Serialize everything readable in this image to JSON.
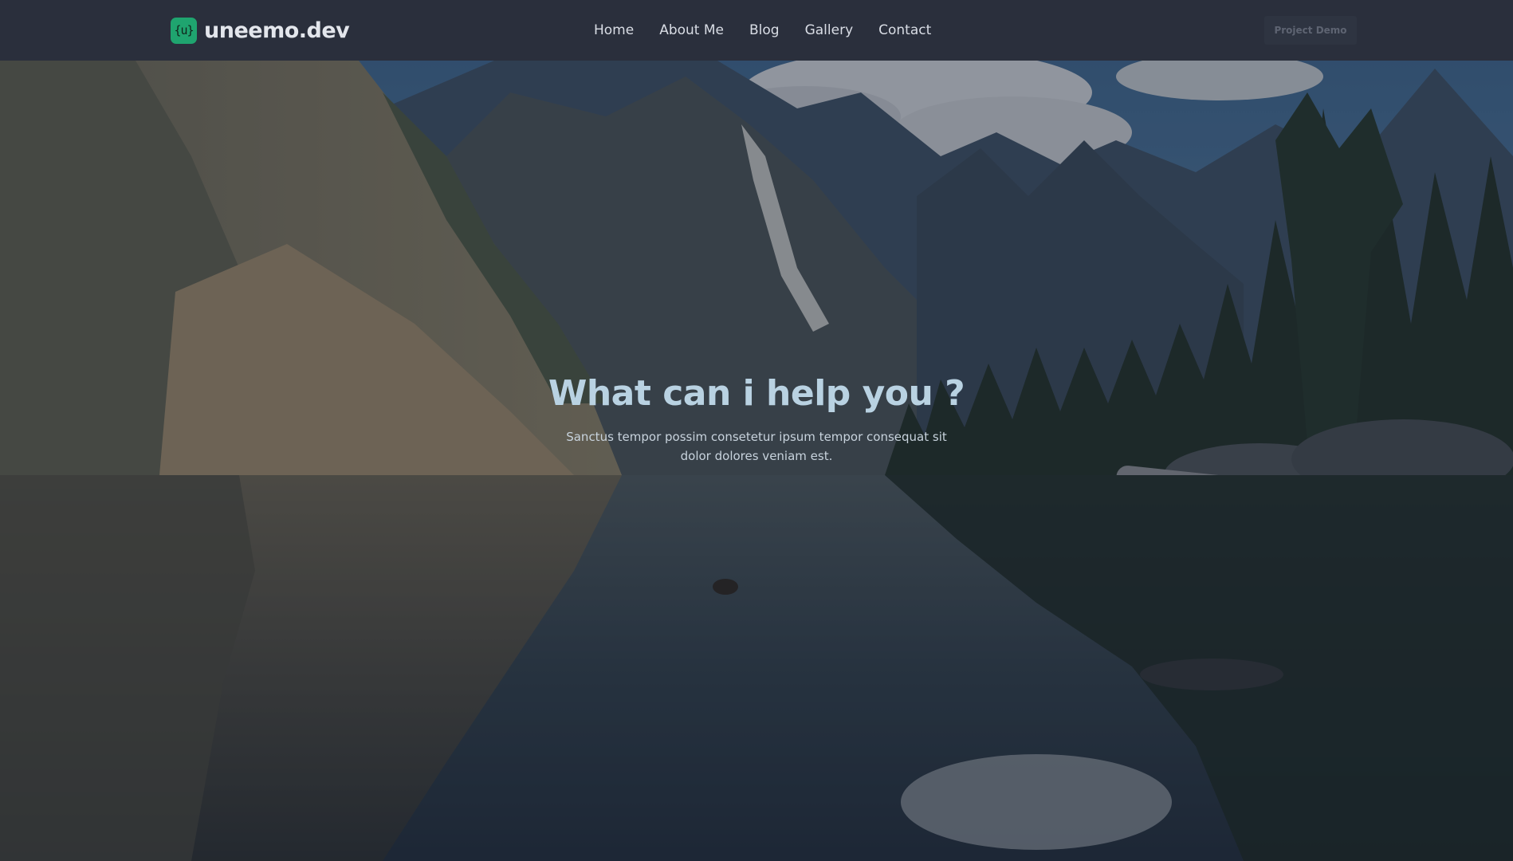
{
  "brand": {
    "logo_text": "{u}",
    "name": "uneemo.dev",
    "logo_color": "#1fa46f"
  },
  "nav": {
    "items": [
      {
        "label": "Home"
      },
      {
        "label": "About Me"
      },
      {
        "label": "Blog"
      },
      {
        "label": "Gallery"
      },
      {
        "label": "Contact"
      }
    ],
    "cta_label": "Project Demo"
  },
  "hero": {
    "title": "What can i help you ?",
    "subtitle": "Sanctus tempor possim consetetur ipsum tempor consequat sit dolor dolores veniam est.",
    "background": "mountain-lake-image"
  },
  "colors": {
    "navbar_bg": "#2a2f3c",
    "title_color": "#b9d2e2"
  }
}
